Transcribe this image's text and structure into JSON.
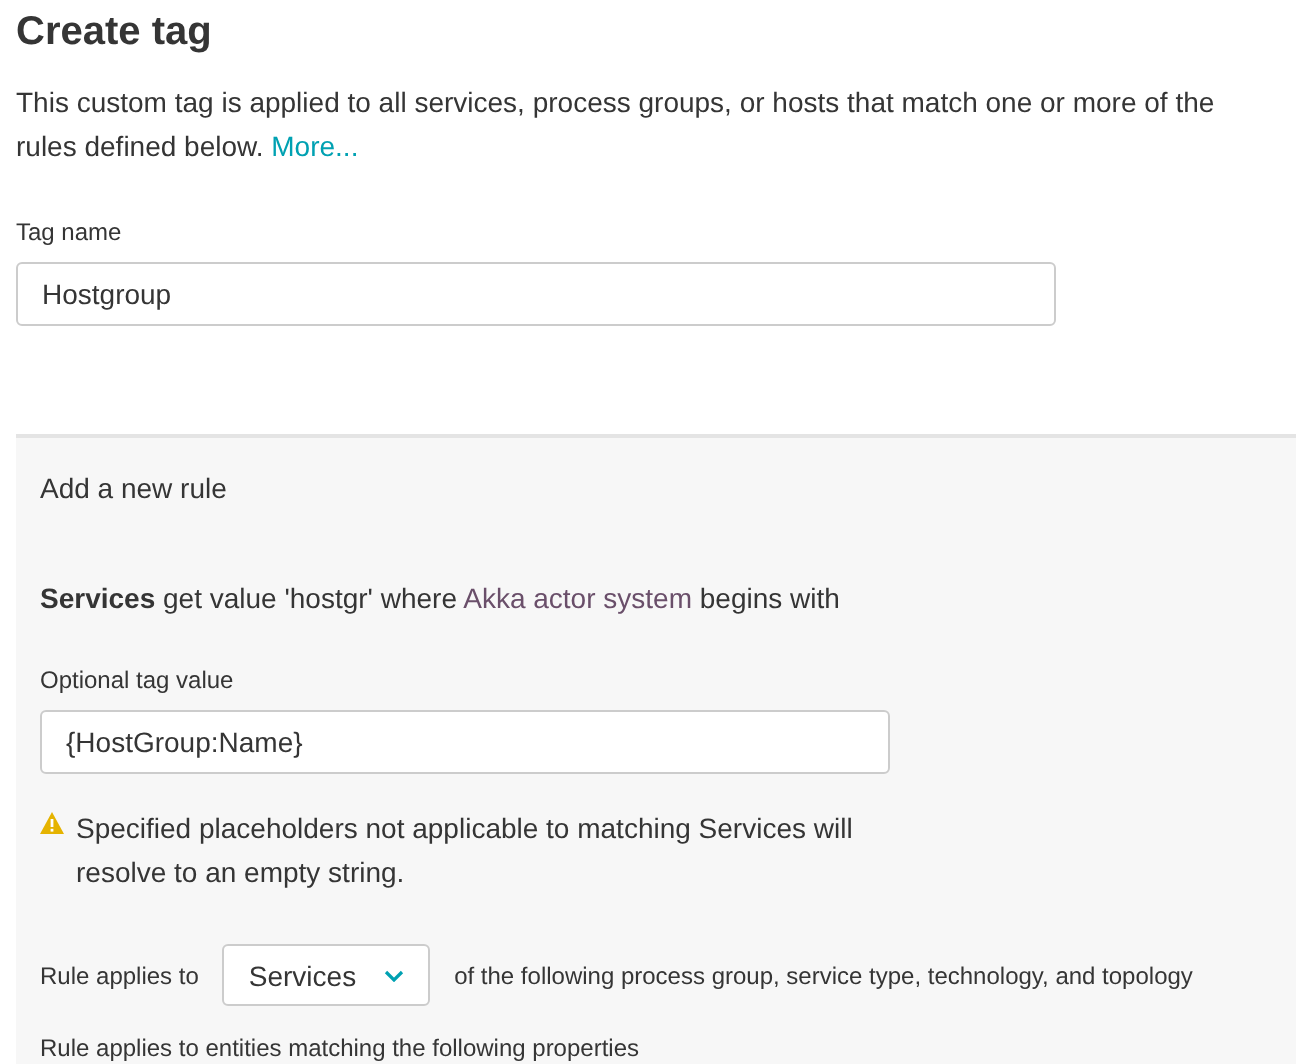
{
  "title": "Create tag",
  "description": {
    "text": "This custom tag is applied to all services, process groups, or hosts that match one or more of the rules defined below.",
    "link": "More..."
  },
  "tag_name": {
    "label": "Tag name",
    "value": "Hostgroup"
  },
  "rule_panel": {
    "heading": "Add a new rule",
    "summary": {
      "subject": "Services",
      "middle": "get value 'hostgr' where",
      "attribute": "Akka actor system",
      "end": "begins with"
    },
    "tag_value": {
      "label": "Optional tag value",
      "value": "{HostGroup:Name}"
    },
    "warning": "Specified placeholders not applicable to matching Services will resolve to an empty string.",
    "applies": {
      "label": "Rule applies to",
      "selected": "Services",
      "suffix": "of the following process group, service type, technology, and topology"
    },
    "properties_label": "Rule applies to entities matching the following properties"
  }
}
